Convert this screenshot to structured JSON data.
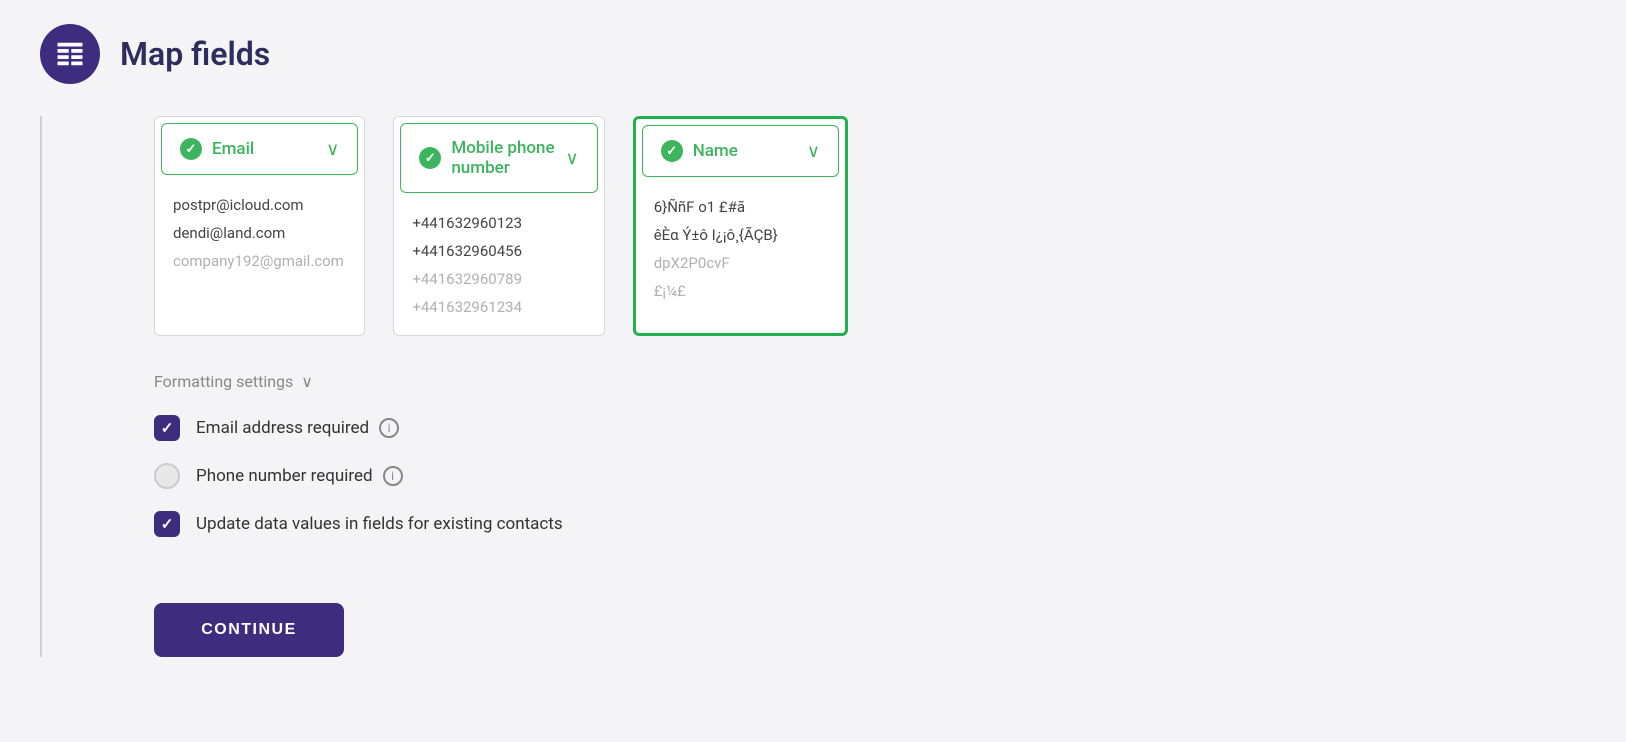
{
  "header": {
    "title": "Map fields",
    "icon": "table-icon"
  },
  "columns": [
    {
      "id": "email",
      "label": "Email",
      "highlighted": false,
      "data": [
        {
          "value": "postpr@icloud.com",
          "faded": false
        },
        {
          "value": "dendi@land.com",
          "faded": false
        },
        {
          "value": "company192@gmail.com",
          "faded": true
        }
      ]
    },
    {
      "id": "mobile_phone",
      "label": "Mobile phone number",
      "highlighted": false,
      "data": [
        {
          "value": "+441632960123",
          "faded": false
        },
        {
          "value": "+441632960456",
          "faded": false
        },
        {
          "value": "+441632960789",
          "faded": true
        },
        {
          "value": "+441632961234",
          "faded": true
        }
      ]
    },
    {
      "id": "name",
      "label": "Name",
      "highlighted": true,
      "data": [
        {
          "value": "6}ÑñF o1 £#ã",
          "faded": false
        },
        {
          "value": "êÈα Ý±ô I¿¡ô¸{ÃÇB}",
          "faded": false
        },
        {
          "value": "dpX2P0cvF",
          "faded": true
        },
        {
          "value": "£¡¼£",
          "faded": true
        }
      ]
    }
  ],
  "formatting": {
    "toggle_label": "Formatting settings",
    "chevron": "∨"
  },
  "checkboxes": [
    {
      "id": "email_required",
      "label": "Email address required",
      "checked": true,
      "has_info": true
    },
    {
      "id": "phone_required",
      "label": "Phone number required",
      "checked": false,
      "has_info": true
    },
    {
      "id": "update_data",
      "label": "Update data values in fields for existing contacts",
      "checked": true,
      "has_info": false
    }
  ],
  "continue_button": {
    "label": "CONTINUE"
  }
}
